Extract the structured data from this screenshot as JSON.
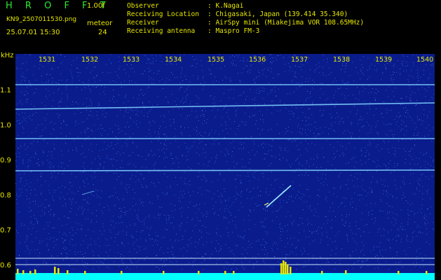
{
  "header": {
    "app_title": "H R O F F T",
    "app_version": "1.00f",
    "file_name": "KN9_2507011530.png",
    "meteor_label": "meteor",
    "date_time": "25.07.01 15:30",
    "meteor_count": "24",
    "info_labels": [
      "Observer",
      "Receiving Location",
      "Receiver",
      "Receiving antenna"
    ],
    "info_values": [
      ": K.Nagai",
      ": Chigasaki, Japan (139.414 35.340)",
      ": AirSpy mini (Miakejima VOR 108.65MHz)",
      ": Maspro FM-3"
    ]
  },
  "axis": {
    "unit": "kHz",
    "y_labels": [
      "1.1",
      "1.0",
      "0.9",
      "0.8",
      "0.7",
      "0.6"
    ],
    "x_labels": [
      "1531",
      "1532",
      "1533",
      "1534",
      "1535",
      "1536",
      "1537",
      "1538",
      "1539",
      "1540"
    ]
  },
  "colors": {
    "text": "#e6e600",
    "title": "#2ee82e",
    "plot_bg": "#0a1c8c",
    "baseline": "#00ffff",
    "trace": "#7fd0ff"
  }
}
